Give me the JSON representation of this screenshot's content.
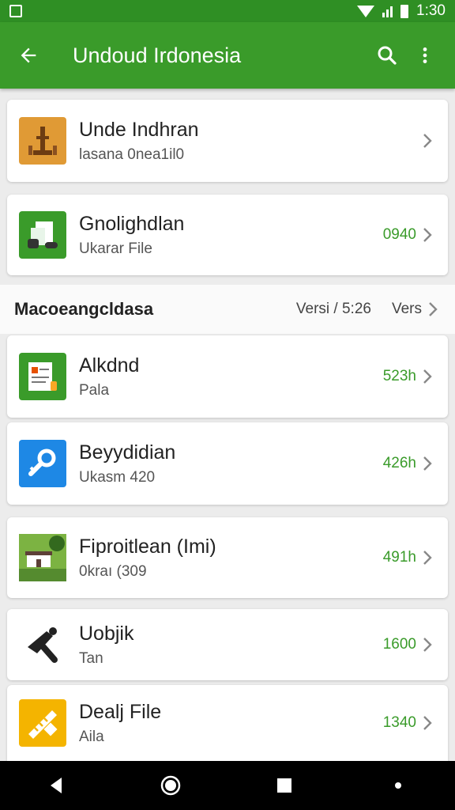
{
  "status_bar": {
    "time": "1:30"
  },
  "app_bar": {
    "title": "Undoud Irdonesia"
  },
  "items": [
    {
      "title": "Unde Indhran",
      "subtitle": "lasana 0nea1il0",
      "value": "",
      "icon": "tower-icon",
      "icon_bg": "#d98a2a"
    },
    {
      "title": "Gnolighdlan",
      "subtitle": "Ukarar File",
      "value": "0940",
      "icon": "documents-icon",
      "icon_bg": "#3a9b2a"
    }
  ],
  "section": {
    "title": "Macoeangcldasa",
    "version": "Versi / 5:26",
    "more_label": "Vers"
  },
  "list": [
    {
      "title": "Alkdnd",
      "subtitle": "Pala",
      "value": "523h",
      "icon": "certificate-icon",
      "icon_bg": "#3a9b2a"
    },
    {
      "title": "Beyydidian",
      "subtitle": "Ukasm 420",
      "value": "426h",
      "icon": "key-search-icon",
      "icon_bg": "#1e88e5"
    },
    {
      "title": "Fiproitlean (Imi)",
      "subtitle": "0kraı (309",
      "value": "491h",
      "icon": "house-icon",
      "icon_bg": "#4caf50"
    },
    {
      "title": "Uobjik",
      "subtitle": "Tan",
      "value": "1600",
      "icon": "tools-icon",
      "icon_bg": "#ffffff"
    },
    {
      "title": "Dealj File",
      "subtitle": "Aila",
      "value": "1340",
      "icon": "ruler-icon",
      "icon_bg": "#f4b400"
    }
  ],
  "colors": {
    "primary": "#3a9b2a",
    "status_bar": "#2f8f24",
    "value_text": "#3a9b2a"
  }
}
